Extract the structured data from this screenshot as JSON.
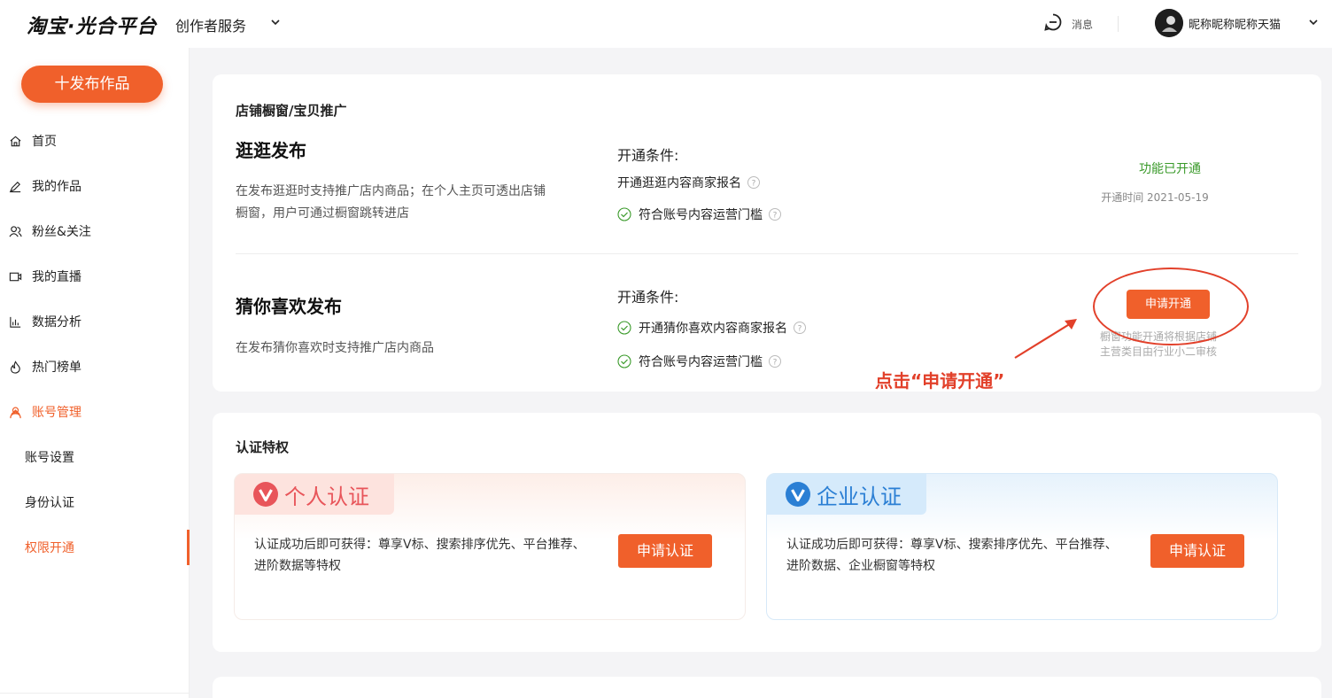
{
  "header": {
    "logo": "淘宝·光合平台",
    "service": "创作者服务",
    "message_label": "消息",
    "username": "昵称昵称昵称天猫"
  },
  "sidebar": {
    "publish_label": "十发布作品",
    "items": [
      {
        "label": "首页",
        "icon": "home-icon"
      },
      {
        "label": "我的作品",
        "icon": "pen-icon"
      },
      {
        "label": "粉丝&关注",
        "icon": "users-icon"
      },
      {
        "label": "我的直播",
        "icon": "video-icon"
      },
      {
        "label": "数据分析",
        "icon": "bar-chart-icon"
      },
      {
        "label": "热门榜单",
        "icon": "flame-icon"
      },
      {
        "label": "账号管理",
        "icon": "user-icon"
      },
      {
        "label": "账号设置"
      },
      {
        "label": "身份认证"
      },
      {
        "label": "权限开通"
      }
    ]
  },
  "shop_section": {
    "title": "店铺橱窗/宝贝推广",
    "features": [
      {
        "title": "逛逛发布",
        "desc_lines": [
          "在发布逛逛时支持推广店内商品；在个人主页可透出店铺",
          "橱窗，用户可通过橱窗跳转进店"
        ],
        "cond_title": "开通条件:",
        "conditions": [
          "开通逛逛内容商家报名",
          "符合账号内容运营门槛"
        ],
        "status": "功能已开通",
        "status_time": "开通时间 2021-05-19"
      },
      {
        "title": "猜你喜欢发布",
        "desc_lines": [
          "在发布猜你喜欢时支持推广店内商品"
        ],
        "cond_title": "开通条件:",
        "conditions": [
          "开通猜你喜欢内容商家报名",
          "符合账号内容运营门槛"
        ],
        "button": "申请开通",
        "note_lines": [
          "橱窗功能开通将根据店铺",
          "主营类目由行业小二审核"
        ]
      }
    ],
    "annotation": "点击“申请开通”"
  },
  "cert_section": {
    "title": "认证特权",
    "personal": {
      "name": "个人认证",
      "desc_lines": [
        "认证成功后即可获得：尊享V标、搜索排序优先、平台推荐、",
        "进阶数据等特权"
      ],
      "button": "申请认证"
    },
    "enterprise": {
      "name": "企业认证",
      "desc_lines": [
        "认证成功后即可获得：尊享V标、搜索排序优先、平台推荐、",
        "进阶数据、企业橱窗等特权"
      ],
      "button": "申请认证"
    }
  },
  "colors": {
    "accent": "#f0602b",
    "success": "#3a9a2a",
    "annotation": "#e2402a",
    "personal": "#e8555a",
    "enterprise": "#2b7fd4"
  }
}
